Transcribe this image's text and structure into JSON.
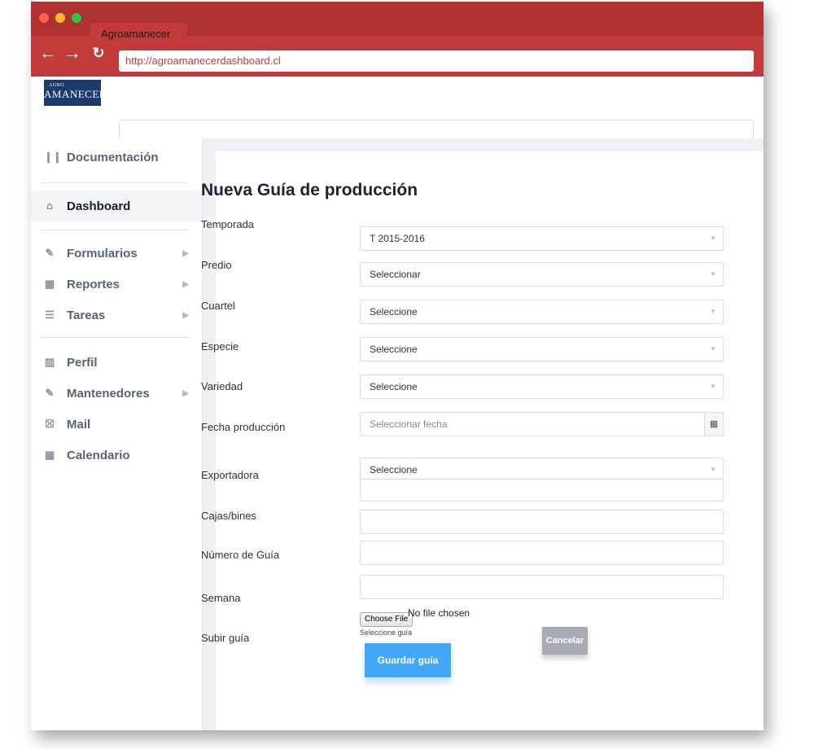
{
  "browser": {
    "tab_title": "Agroamanecer",
    "url": "http://agroamanecerdashboard.cl",
    "back_icon": "arrow-left-icon",
    "forward_icon": "arrow-right-icon",
    "reload_icon": "reload-icon"
  },
  "logo": {
    "top": "AGRO",
    "name": "AMANECER"
  },
  "sidebar": {
    "items": [
      {
        "label": "Documentación",
        "icon": "books-icon"
      },
      {
        "label": "Dashboard",
        "icon": "home-icon",
        "active": true
      },
      {
        "label": "Formularios",
        "icon": "edit-icon",
        "submenu": true
      },
      {
        "label": "Reportes",
        "icon": "grid-icon",
        "submenu": true
      },
      {
        "label": "Tareas",
        "icon": "layers-icon",
        "submenu": true
      },
      {
        "label": "Perfil",
        "icon": "profile-icon"
      },
      {
        "label": "Mantenedores",
        "icon": "edit-icon",
        "submenu": true
      },
      {
        "label": "Mail",
        "icon": "mail-icon"
      },
      {
        "label": "Calendario",
        "icon": "calendar-icon"
      }
    ]
  },
  "form": {
    "title": "Nueva Guía de producción",
    "labels": {
      "temporada": "Temporada",
      "predio": "Predio",
      "cuartel": "Cuartel",
      "especie": "Especie",
      "variedad": "Variedad",
      "fecha": "Fecha producción",
      "exportadora": "Exportadora",
      "cajas": "Cajas/bines",
      "numero": "Número de Guía",
      "semana": "Semana",
      "subir": "Subir guía"
    },
    "values": {
      "temporada": "T 2015-2016",
      "predio": "Seleccionar",
      "cuartel": "Seleccione",
      "especie": "Seleccione",
      "variedad": "Seleccione",
      "exportadora": "Seleccione",
      "cajas": "",
      "numero": "",
      "semana": ""
    },
    "fecha_placeholder": "Seleccionar fecha",
    "file_button": "Choose File",
    "file_status": "No file chosen",
    "file_help": "Seleccione guía",
    "save_label": "Guardar guía",
    "cancel_label": "Cancelar"
  },
  "colors": {
    "chrome": "#c23b3b",
    "primary_button": "#42a5f5",
    "secondary_button": "#a7acb4",
    "content_bg": "#eef0f4"
  }
}
